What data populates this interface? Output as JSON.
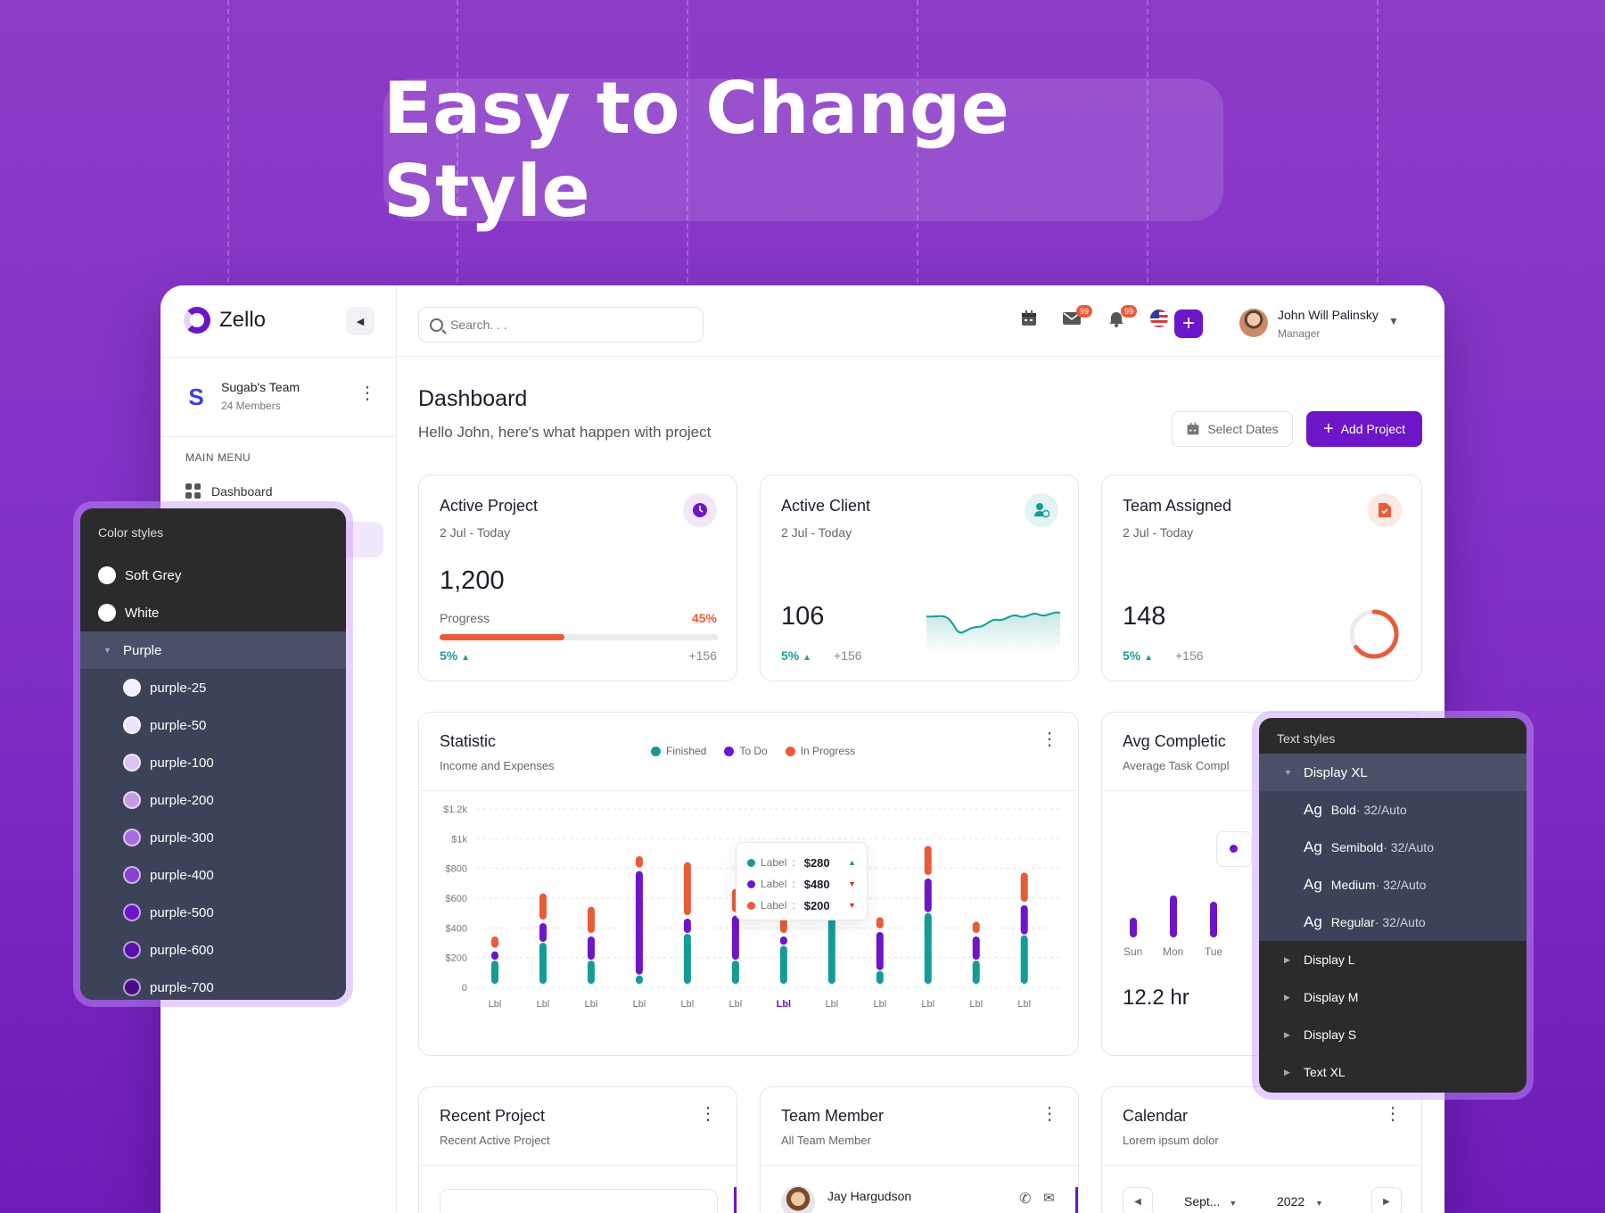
{
  "hero": {
    "title": "Easy to Change Style"
  },
  "sidebar": {
    "logo": "Zello",
    "team_name": "Sugab's Team",
    "team_members": "24 Members",
    "menu_title": "MAIN MENU",
    "nav_dashboard": "Dashboard"
  },
  "topbar": {
    "search_placeholder": "Search. . .",
    "mail_badge": "99",
    "bell_badge": "99",
    "user_name": "John Will Palinsky",
    "user_role": "Manager"
  },
  "dashboard": {
    "title": "Dashboard",
    "subtitle": "Hello John, here's what happen with project",
    "select_dates": "Select Dates",
    "add_project": "Add Project"
  },
  "cards": {
    "active_project": {
      "title": "Active Project",
      "date": "2 Jul - Today",
      "value": "1,200",
      "progress_label": "Progress",
      "progress_pct": "45%",
      "progress": 0.45,
      "change": "5%",
      "count": "+156"
    },
    "active_client": {
      "title": "Active Client",
      "date": "2 Jul - Today",
      "value": "106",
      "change": "5%",
      "count": "+156"
    },
    "team_assigned": {
      "title": "Team Assigned",
      "date": "2 Jul - Today",
      "value": "148",
      "change": "5%",
      "count": "+156",
      "ring": 0.65
    }
  },
  "statistic": {
    "title": "Statistic",
    "subtitle": "Income and Expenses",
    "legend": [
      "Finished",
      "To Do",
      "In Progress"
    ]
  },
  "tooltip": [
    {
      "label": "Label",
      "value": "$280"
    },
    {
      "label": "Label",
      "value": "$480"
    },
    {
      "label": "Label",
      "value": "$200"
    }
  ],
  "avg": {
    "title": "Avg Completic",
    "subtitle": "Average Task Compl",
    "days": [
      "Sun",
      "Mon",
      "Tue"
    ],
    "value": "12.2 hr"
  },
  "recent_project": {
    "title": "Recent Project",
    "subtitle": "Recent Active Project"
  },
  "team_member": {
    "title": "Team Member",
    "subtitle": "All Team Member",
    "member_name": "Jay Hargudson"
  },
  "calendar": {
    "title": "Calendar",
    "subtitle": "Lorem ipsum dolor",
    "month": "Sept...",
    "year": "2022"
  },
  "color_styles": {
    "title": "Color styles",
    "items": [
      {
        "name": "Soft Grey",
        "color": "#ffffff"
      },
      {
        "name": "White",
        "color": "#ffffff"
      }
    ],
    "group": "Purple",
    "purples": [
      {
        "name": "purple-25",
        "color": "#f6f0fd"
      },
      {
        "name": "purple-50",
        "color": "#efe3fb"
      },
      {
        "name": "purple-100",
        "color": "#ddc3f4"
      },
      {
        "name": "purple-200",
        "color": "#c49be9"
      },
      {
        "name": "purple-300",
        "color": "#a66ddb"
      },
      {
        "name": "purple-400",
        "color": "#8b40d1"
      },
      {
        "name": "purple-500",
        "color": "#6d16c9"
      },
      {
        "name": "purple-600",
        "color": "#5a10a8"
      },
      {
        "name": "purple-700",
        "color": "#470c85"
      }
    ]
  },
  "text_styles": {
    "title": "Text styles",
    "group": "Display XL",
    "subs": [
      {
        "ag": "Ag",
        "weight": "Bold",
        "info": " · 32/Auto"
      },
      {
        "ag": "Ag",
        "weight": "Semibold",
        "info": " · 32/Auto"
      },
      {
        "ag": "Ag",
        "weight": "Medium",
        "info": " · 32/Auto"
      },
      {
        "ag": "Ag",
        "weight": "Regular",
        "info": " · 32/Auto"
      }
    ],
    "others": [
      "Display L",
      "Display M",
      "Display S",
      "Text XL"
    ]
  },
  "colors": {
    "primary": "#6d16c9",
    "teal": "#149c98",
    "orange": "#ea5b3a"
  },
  "chart_data": {
    "type": "bar",
    "stacked": true,
    "categories": [
      "Lbl",
      "Lbl",
      "Lbl",
      "Lbl",
      "Lbl",
      "Lbl",
      "Lbl",
      "Lbl",
      "Lbl",
      "Lbl",
      "Lbl",
      "Lbl"
    ],
    "highlight_index": 6,
    "y_ticks": [
      "0",
      "$200",
      "$400",
      "$600",
      "$800",
      "$1k",
      "$1.2k"
    ],
    "ylim": [
      0,
      1200
    ],
    "series": [
      {
        "name": "Finished",
        "color": "#149c98",
        "values": [
          180,
          300,
          180,
          80,
          360,
          180,
          280,
          700,
          110,
          500,
          180,
          350
        ]
      },
      {
        "name": "To Do",
        "color": "#6d16c9",
        "values": [
          80,
          150,
          180,
          720,
          120,
          320,
          80,
          20,
          280,
          250,
          180,
          220
        ]
      },
      {
        "name": "In Progress",
        "color": "#ea5b3a",
        "values": [
          100,
          200,
          200,
          100,
          380,
          180,
          150,
          70,
          100,
          220,
          100,
          220
        ]
      }
    ]
  }
}
